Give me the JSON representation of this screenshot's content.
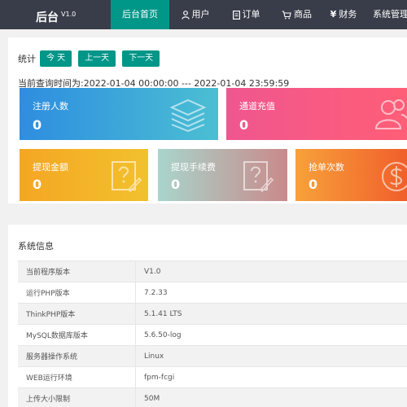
{
  "brand": {
    "name": "后台",
    "version": "V1.0"
  },
  "nav": [
    {
      "label": "后台首页",
      "icon": "",
      "active": true
    },
    {
      "label": "用户",
      "icon": "user-icon"
    },
    {
      "label": "订单",
      "icon": "order-icon"
    },
    {
      "label": "商品",
      "icon": "cart-icon"
    },
    {
      "label": "财务",
      "icon": "yen-icon"
    },
    {
      "label": "系统管理",
      "icon": ""
    }
  ],
  "stats": {
    "label": "统计",
    "buttons": {
      "today": "今 天",
      "prev": "上一天",
      "next": "下一天"
    },
    "query_time": "当前查询时间为:2022-01-04 00:00:00 --- 2022-01-04 23:59:59"
  },
  "cards": [
    {
      "title": "注册人数",
      "value": "0",
      "icon": "layers-icon",
      "color_from": "#2e8de0",
      "color_to": "#4bbfd3"
    },
    {
      "title": "通道充值",
      "value": "0",
      "icon": "users-icon",
      "color_from": "#f0568f",
      "color_to": "#ff5e77"
    },
    {
      "title": "提现金额",
      "value": "0",
      "icon": "question-edit-icon",
      "color_from": "#f5a623",
      "color_to": "#f2c12e"
    },
    {
      "title": "提现手续费",
      "value": "0",
      "icon": "question-edit-icon",
      "color_from": "#a8d5cc",
      "color_to": "#c98a8a"
    },
    {
      "title": "抢单次数",
      "value": "0",
      "icon": "dollar-icon",
      "color_from": "#f8a13a",
      "color_to": "#f05f2b"
    }
  ],
  "system": {
    "title": "系统信息",
    "rows": [
      {
        "key": "当前程序版本",
        "value": "V1.0"
      },
      {
        "key": "运行PHP版本",
        "value": "7.2.33"
      },
      {
        "key": "ThinkPHP版本",
        "value": "5.1.41 LTS"
      },
      {
        "key": "MySQL数据库版本",
        "value": "5.6.50-log"
      },
      {
        "key": "服务器操作系统",
        "value": "Linux"
      },
      {
        "key": "WEB运行环境",
        "value": "fpm-fcgi"
      },
      {
        "key": "上传大小限制",
        "value": "50M"
      }
    ]
  },
  "colors": {
    "nav_bg": "#393d49",
    "accent": "#009688"
  }
}
